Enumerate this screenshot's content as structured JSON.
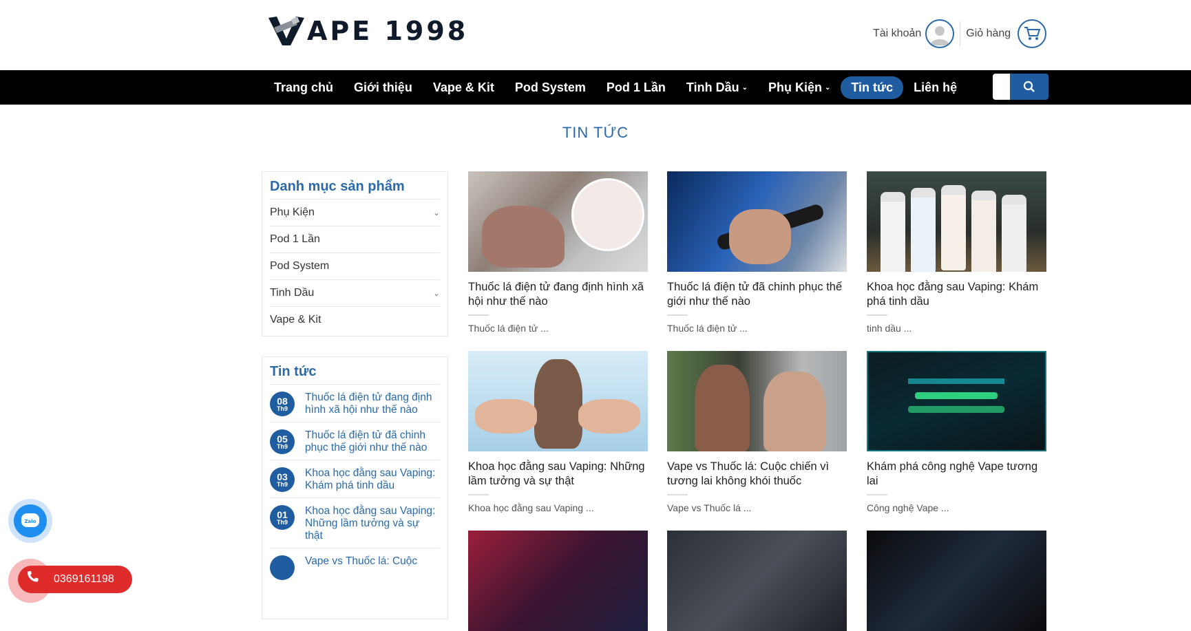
{
  "header": {
    "logo_text": "APE 1998",
    "account_label": "Tài khoản",
    "cart_label": "Giỏ hàng"
  },
  "nav": {
    "items": [
      "Trang chủ",
      "Giới thiệu",
      "Vape & Kit",
      "Pod System",
      "Pod 1 Lần",
      "Tinh Dầu",
      "Phụ Kiện",
      "Tin tức",
      "Liên hệ"
    ],
    "active": "Tin tức"
  },
  "page_title": "TIN TỨC",
  "sidebar": {
    "categories_title": "Danh mục sản phẩm",
    "categories": [
      {
        "label": "Phụ Kiện",
        "expandable": true
      },
      {
        "label": "Pod 1 Lần",
        "expandable": false
      },
      {
        "label": "Pod System",
        "expandable": false
      },
      {
        "label": "Tinh Dầu",
        "expandable": true
      },
      {
        "label": "Vape & Kit",
        "expandable": false
      }
    ],
    "news_title": "Tin tức",
    "news": [
      {
        "day": "08",
        "month": "Th9",
        "title": "Thuốc lá điện tử đang định hình xã hội như thế nào"
      },
      {
        "day": "05",
        "month": "Th9",
        "title": "Thuốc lá điện tử đã chinh phục thế giới như thế nào"
      },
      {
        "day": "03",
        "month": "Th9",
        "title": "Khoa học đằng sau Vaping: Khám phá tinh dầu"
      },
      {
        "day": "01",
        "month": "Th9",
        "title": "Khoa học đằng sau Vaping: Những lầm tưởng và sự thật"
      },
      {
        "day": "",
        "month": "",
        "title": "Vape vs Thuốc lá: Cuộc"
      }
    ]
  },
  "posts": [
    {
      "title": "Thuốc lá điện tử đang định hình xã hội như thế nào",
      "excerpt": "Thuốc lá điện tử ..."
    },
    {
      "title": "Thuốc lá điện tử đã chinh phục thế giới như thế nào",
      "excerpt": "Thuốc lá điện tử ..."
    },
    {
      "title": "Khoa học đằng sau Vaping: Khám phá tinh dầu",
      "excerpt": "tinh dầu ..."
    },
    {
      "title": "Khoa học đằng sau Vaping: Những lầm tưởng và sự thật",
      "excerpt": "Khoa học đằng sau Vaping ..."
    },
    {
      "title": "Vape vs Thuốc lá: Cuộc chiến vì tương lai không khói thuốc",
      "excerpt": "Vape vs Thuốc lá ..."
    },
    {
      "title": "Khám phá công nghệ Vape tương lai",
      "excerpt": "Công nghệ Vape ..."
    }
  ],
  "floating": {
    "zalo_label": "Zalo",
    "phone_number": "0369161198"
  },
  "colors": {
    "brand": "#1f5da0",
    "nav_bg": "#000000",
    "title": "#2a6aa8",
    "phone": "#e02b2b"
  }
}
